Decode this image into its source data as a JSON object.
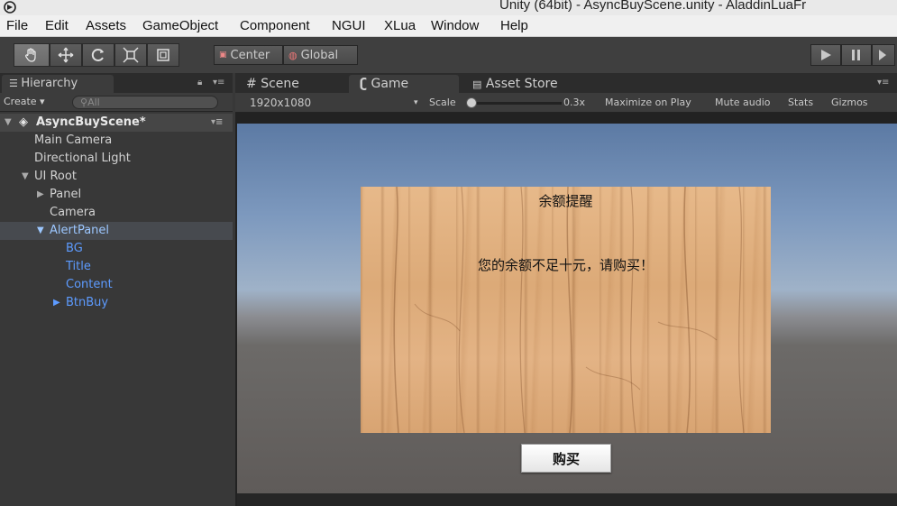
{
  "window": {
    "title": "Unity (64bit) - AsyncBuyScene.unity - AladdinLuaFr"
  },
  "menu": [
    "File",
    "Edit",
    "Assets",
    "GameObject",
    "Component",
    "NGUI",
    "XLua",
    "Window",
    "Help"
  ],
  "toolbar": {
    "tools": [
      "hand-tool-icon",
      "move-tool-icon",
      "rotate-tool-icon",
      "scale-tool-icon",
      "rect-tool-icon"
    ],
    "pivot_label": "Center",
    "space_label": "Global"
  },
  "hierarchy": {
    "tab_label": "Hierarchy",
    "create_label": "Create ▾",
    "search_placeholder": "All",
    "scene_name": "AsyncBuyScene*",
    "items": [
      {
        "label": "Main Camera"
      },
      {
        "label": "Directional Light"
      },
      {
        "label": "UI Root"
      },
      {
        "label": "Panel"
      },
      {
        "label": "Camera"
      },
      {
        "label": "AlertPanel"
      },
      {
        "label": "BG"
      },
      {
        "label": "Title"
      },
      {
        "label": "Content"
      },
      {
        "label": "BtnBuy"
      }
    ]
  },
  "game_panel": {
    "tabs": [
      {
        "label": "Scene"
      },
      {
        "label": "Game"
      },
      {
        "label": "Asset Store"
      }
    ],
    "resolution": "1920x1080",
    "scale_label": "Scale",
    "scale_value": "0.3x",
    "maximize_label": "Maximize on Play",
    "mute_label": "Mute audio",
    "stats_label": "Stats",
    "gizmos_label": "Gizmos"
  },
  "alert": {
    "title": "余额提醒",
    "content": "您的余额不足十元，请购买！",
    "buy_label": "购买"
  },
  "colors": {
    "editor_bg": "#383838",
    "selected_text": "#9cc7ff",
    "child_text": "#5d9bff"
  }
}
